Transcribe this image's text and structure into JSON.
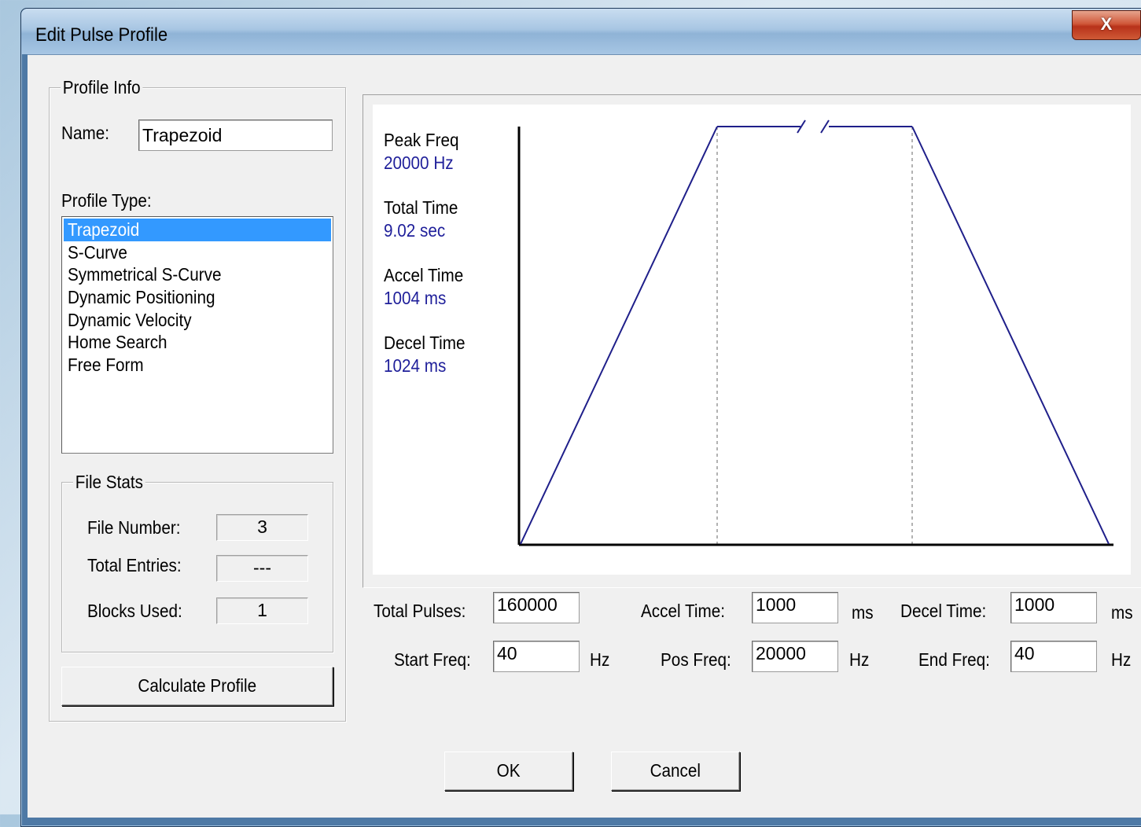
{
  "window": {
    "title": "Edit Pulse Profile",
    "close_label": "X"
  },
  "profile_info": {
    "legend": "Profile Info",
    "name_label": "Name:",
    "name_value": "Trapezoid",
    "type_label": "Profile Type:",
    "types": [
      "Trapezoid",
      "S-Curve",
      "Symmetrical S-Curve",
      "Dynamic Positioning",
      "Dynamic Velocity",
      "Home Search",
      "Free Form"
    ],
    "selected_type": "Trapezoid"
  },
  "file_stats": {
    "legend": "File Stats",
    "file_number_label": "File Number:",
    "file_number": "3",
    "total_entries_label": "Total Entries:",
    "total_entries": "---",
    "blocks_used_label": "Blocks Used:",
    "blocks_used": "1"
  },
  "calculate_label": "Calculate Profile",
  "summary": {
    "peak_freq_label": "Peak Freq",
    "peak_freq": "20000 Hz",
    "total_time_label": "Total Time",
    "total_time": "9.02 sec",
    "accel_time_label": "Accel Time",
    "accel_time": "1004 ms",
    "decel_time_label": "Decel Time",
    "decel_time": "1024 ms"
  },
  "params": {
    "total_pulses_label": "Total Pulses:",
    "total_pulses": "160000",
    "accel_time_label": "Accel Time:",
    "accel_time": "1000",
    "accel_unit": "ms",
    "decel_time_label": "Decel Time:",
    "decel_time": "1000",
    "decel_unit": "ms",
    "start_freq_label": "Start Freq:",
    "start_freq": "40",
    "start_unit": "Hz",
    "pos_freq_label": "Pos Freq:",
    "pos_freq": "20000",
    "pos_unit": "Hz",
    "end_freq_label": "End Freq:",
    "end_freq": "40",
    "end_unit": "Hz"
  },
  "buttons": {
    "ok": "OK",
    "cancel": "Cancel"
  },
  "chart_data": {
    "type": "line",
    "title": "",
    "xlabel": "",
    "ylabel": "",
    "x_break": true,
    "series": [
      {
        "x_phases": [
          "start",
          "accel_end",
          "decel_start",
          "end"
        ],
        "y": [
          40,
          20000,
          20000,
          40
        ]
      }
    ],
    "colors": {
      "profile_line": "#1f1f8a",
      "axis": "#000000",
      "phase_divider": "#808080"
    }
  }
}
